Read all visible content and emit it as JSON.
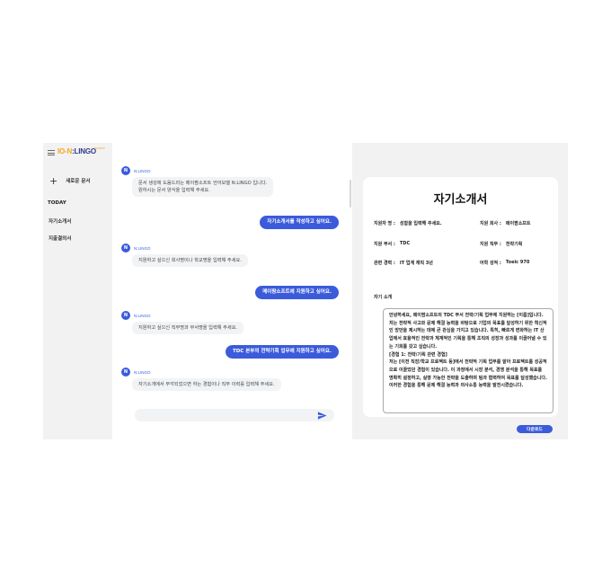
{
  "sidebar": {
    "logo_text_left": "",
    "logo_text_accent": "IO-N",
    "logo_text_right": ":LINGO",
    "logo_sub": "TRADEM",
    "new_doc_label": "새로운 문서",
    "section_today": "TODAY",
    "history": [
      "자기소개서",
      "지출결의서"
    ]
  },
  "chat": {
    "bot_name": "N:LINGO",
    "messages": [
      {
        "role": "bot",
        "text": "문서 생성에 도움드리는 메이팜소프트 언어모델 N:LINGO 입니다.\n원하시는 문서 양식을 입력해 주세요."
      },
      {
        "role": "user",
        "text": "자기소개서를 작성하고 싶어요."
      },
      {
        "role": "bot",
        "text": "지원하고 싶으신 회사명이나 학교명을 입력해 주세요."
      },
      {
        "role": "user",
        "text": "메이팜소프트에 지원하고 싶어요."
      },
      {
        "role": "bot",
        "text": "지원하고 싶으신 직무명과 부서명을 입력해 주세요."
      },
      {
        "role": "user",
        "text": "TDC 본부의 전략기획 업무에 지원하고 싶어요."
      },
      {
        "role": "bot",
        "text": "자기소개에서 부각되었으면 하는 경험이나 직무 이력를 입력해 주세요."
      }
    ],
    "input_placeholder": ""
  },
  "document": {
    "title": "자기소개서",
    "fields": {
      "applicant_label": "지원자 명 :",
      "applicant_value": "성함을 입력해 주세요.",
      "company_label": "지원 회사 :",
      "company_value": "메이팜소프트",
      "dept_label": "지원 부서 :",
      "dept_value": "TDC",
      "job_label": "지원 직무 :",
      "job_value": "전략기획",
      "career_label": "관련 경력 :",
      "career_value": "IT 업계 재직 3년",
      "lang_label": "어학 성적 :",
      "lang_value": "Toeic 970"
    },
    "intro_label": "자기 소개",
    "intro_text": "안녕하세요, 메이팜소프트의 TDC 부서 전략/기획 업무에 지원하는 [이름]입니다.\n저는 전략적 사고와 문제 해결 능력을 바탕으로 기업의 목표를 달성하기 위한 혁신적인 방안을 제시하는 데에 큰 관심을 가지고 있습니다. 특히, 빠르게 변화하는 IT 산업에서 효율적인 전략과 체계적인 기획을 통해 조직의 성장과 성과를 이끌어낼 수 있는 기회를 갖고 싶습니다.\n[경험 1: 전략/기획 관련 경험]\n저는 [이전 직장/학교 프로젝트 등]에서 전략적 기획 업무를 맡아 프로젝트를 성공적으로 이끌었던 경험이 있습니다. 이 과정에서 시장 분석, 경쟁 분석을 통해 목표를 명확히 설정하고, 실행 가능한 전략을 도출하며 팀과 협력하여 목표를 달성했습니다. 이러한 경험을 통해 문제 해결 능력과 의사소통 능력을 발전시켰습니다.",
    "download_label": "다운로드"
  },
  "colors": {
    "accent": "#3b5bdb",
    "sidebar_bg": "#f2f2f2",
    "bubble_bg": "#f1f3f5",
    "logo_accent": "#f5a623"
  }
}
